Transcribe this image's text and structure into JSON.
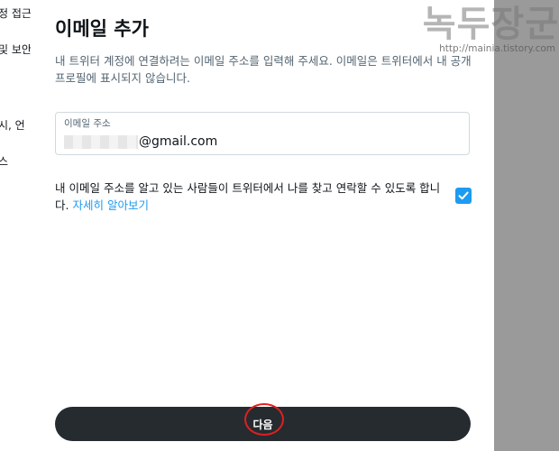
{
  "background": {
    "lines": [
      "정 접근",
      "및 보안",
      "시, 언",
      "스"
    ]
  },
  "modal": {
    "title": "이메일 추가",
    "description": "내 트위터 계정에 연결하려는 이메일 주소를 입력해 주세요. 이메일은 트위터에서 내 공개 프로필에 표시되지 않습니다.",
    "email_field": {
      "label": "이메일 주소",
      "value_suffix": "@gmail.com"
    },
    "consent": {
      "text": "내 이메일 주소를 알고 있는 사람들이 트위터에서 나를 찾고 연락할 수 있도록 합니다.",
      "link": "자세히 알아보기",
      "checked": true
    },
    "next_button": "다음"
  },
  "watermark": {
    "logo": "녹두장군",
    "url": "http://mainia.tistory.com"
  },
  "colors": {
    "accent": "#1d9bf0",
    "button": "#262b30",
    "annotation": "#e02020",
    "overlay": "#9a9a9a"
  }
}
